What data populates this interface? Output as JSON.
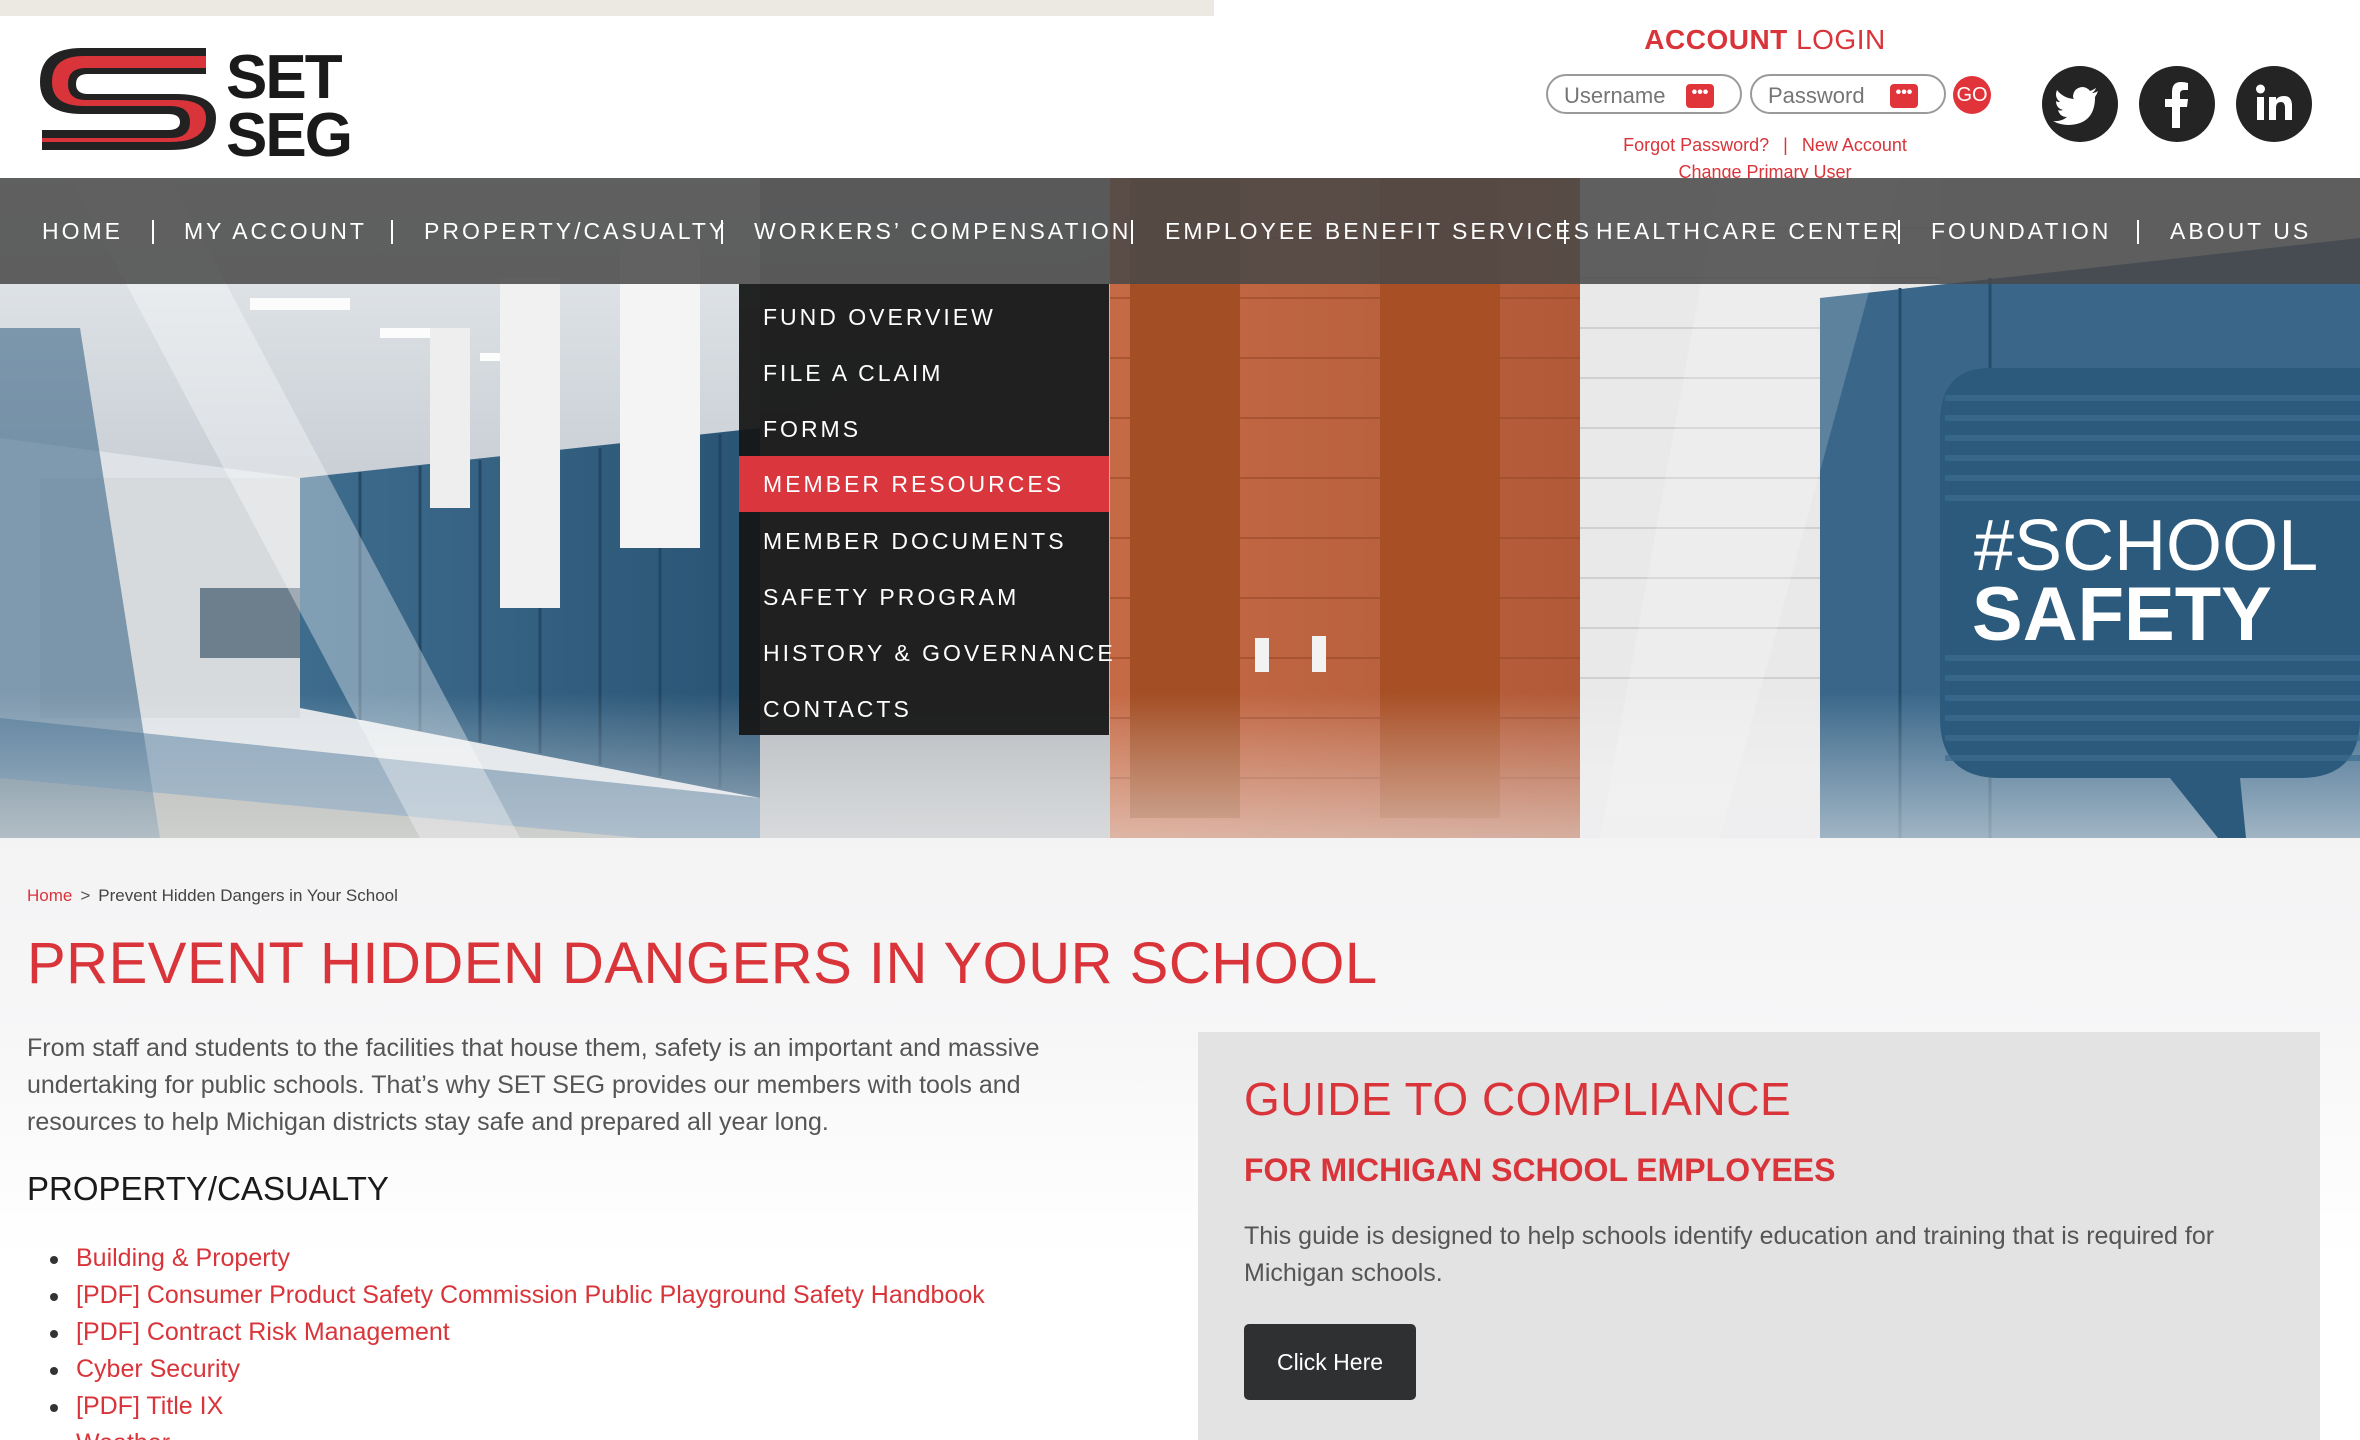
{
  "brand": {
    "name_line1": "SET",
    "name_line2": "SEG",
    "accent_color": "#d9343a"
  },
  "login": {
    "title_bold": "ACCOUNT",
    "title_light": "LOGIN",
    "username_placeholder": "Username",
    "password_placeholder": "Password",
    "field_icon": "•••",
    "go_label": "GO",
    "forgot": "Forgot Password?",
    "separator": "|",
    "new_account": "New Account",
    "change_user": "Change Primary User"
  },
  "social": [
    {
      "name": "twitter-icon"
    },
    {
      "name": "facebook-icon"
    },
    {
      "name": "linkedin-icon"
    }
  ],
  "nav": {
    "items": [
      {
        "label": "HOME"
      },
      {
        "label": "MY ACCOUNT"
      },
      {
        "label": "PROPERTY/CASUALTY"
      },
      {
        "label": "WORKERS’ COMPENSATION"
      },
      {
        "label": "EMPLOYEE BENEFIT SERVICES"
      },
      {
        "label": "HEALTHCARE CENTER"
      },
      {
        "label": "FOUNDATION"
      },
      {
        "label": "ABOUT US"
      }
    ]
  },
  "dropdown": {
    "items": [
      {
        "label": "FUND OVERVIEW"
      },
      {
        "label": "FILE A CLAIM"
      },
      {
        "label": "FORMS"
      },
      {
        "label": "MEMBER RESOURCES"
      },
      {
        "label": "MEMBER DOCUMENTS"
      },
      {
        "label": "SAFETY PROGRAM"
      },
      {
        "label": "HISTORY & GOVERNANCE"
      },
      {
        "label": "CONTACTS"
      }
    ],
    "active": "MEMBER RESOURCES"
  },
  "hero": {
    "badge_line1": "#SCHOOL",
    "badge_line2": "SAFETY"
  },
  "breadcrumb": {
    "home": "Home",
    "separator": ">",
    "current": "Prevent Hidden Dangers in Your School"
  },
  "page": {
    "title": "PREVENT HIDDEN DANGERS IN YOUR SCHOOL",
    "intro": "From staff and students to the facilities that house them, safety is an important and massive undertaking for public schools. That’s why SET SEG provides our members with tools and resources to help Michigan districts stay safe and prepared all year long.",
    "section_heading": "PROPERTY/CASUALTY",
    "links": [
      "Building & Property",
      "[PDF] Consumer Product Safety Commission Public Playground Safety Handbook",
      "[PDF] Contract Risk Management",
      "Cyber Security",
      "[PDF] Title IX",
      "Weather"
    ]
  },
  "guide": {
    "title": "GUIDE TO COMPLIANCE",
    "subtitle": "FOR MICHIGAN SCHOOL EMPLOYEES",
    "text": "This guide is designed to help schools identify education and training that is required for Michigan schools.",
    "button": "Click Here"
  }
}
